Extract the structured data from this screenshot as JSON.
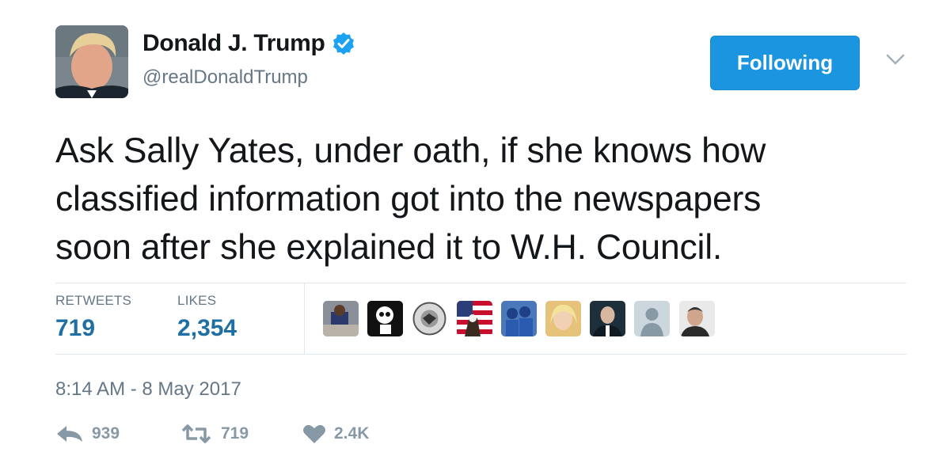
{
  "author": {
    "display_name": "Donald J. Trump",
    "handle": "@realDonaldTrump",
    "verified_color": "#1da1f2",
    "avatar_icon": "profile-photo"
  },
  "follow_button": {
    "label": "Following",
    "color": "#1b95e0"
  },
  "menu": {
    "icon": "chevron-down-icon"
  },
  "tweet": {
    "lines": [
      "Ask Sally Yates, under oath, if she knows how",
      "classified information got into the newspapers",
      "soon after she explained it to W.H. Council."
    ]
  },
  "stats": {
    "retweets_label": "RETWEETS",
    "retweets_value": "719",
    "likes_label": "LIKES",
    "likes_value": "2,354"
  },
  "liked_by_avatars": [
    "avatar-1",
    "avatar-2",
    "avatar-3",
    "avatar-4",
    "avatar-5",
    "avatar-6",
    "avatar-7",
    "avatar-8",
    "avatar-9"
  ],
  "timestamp": "8:14 AM - 8 May 2017",
  "actions": {
    "reply_count": "939",
    "retweet_count": "719",
    "like_count": "2.4K"
  }
}
